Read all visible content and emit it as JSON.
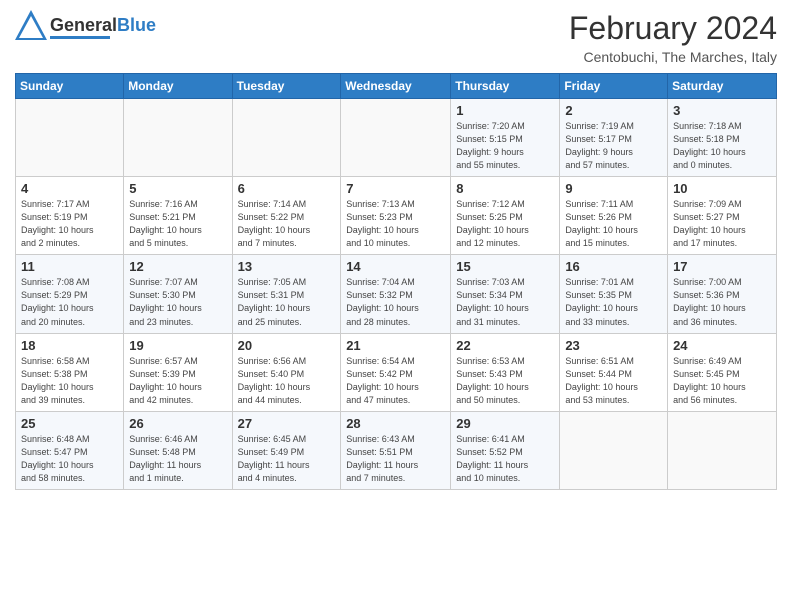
{
  "header": {
    "logo_general": "General",
    "logo_blue": "Blue",
    "month_title": "February 2024",
    "location": "Centobuchi, The Marches, Italy"
  },
  "weekdays": [
    "Sunday",
    "Monday",
    "Tuesday",
    "Wednesday",
    "Thursday",
    "Friday",
    "Saturday"
  ],
  "weeks": [
    [
      {
        "day": "",
        "info": ""
      },
      {
        "day": "",
        "info": ""
      },
      {
        "day": "",
        "info": ""
      },
      {
        "day": "",
        "info": ""
      },
      {
        "day": "1",
        "info": "Sunrise: 7:20 AM\nSunset: 5:15 PM\nDaylight: 9 hours\nand 55 minutes."
      },
      {
        "day": "2",
        "info": "Sunrise: 7:19 AM\nSunset: 5:17 PM\nDaylight: 9 hours\nand 57 minutes."
      },
      {
        "day": "3",
        "info": "Sunrise: 7:18 AM\nSunset: 5:18 PM\nDaylight: 10 hours\nand 0 minutes."
      }
    ],
    [
      {
        "day": "4",
        "info": "Sunrise: 7:17 AM\nSunset: 5:19 PM\nDaylight: 10 hours\nand 2 minutes."
      },
      {
        "day": "5",
        "info": "Sunrise: 7:16 AM\nSunset: 5:21 PM\nDaylight: 10 hours\nand 5 minutes."
      },
      {
        "day": "6",
        "info": "Sunrise: 7:14 AM\nSunset: 5:22 PM\nDaylight: 10 hours\nand 7 minutes."
      },
      {
        "day": "7",
        "info": "Sunrise: 7:13 AM\nSunset: 5:23 PM\nDaylight: 10 hours\nand 10 minutes."
      },
      {
        "day": "8",
        "info": "Sunrise: 7:12 AM\nSunset: 5:25 PM\nDaylight: 10 hours\nand 12 minutes."
      },
      {
        "day": "9",
        "info": "Sunrise: 7:11 AM\nSunset: 5:26 PM\nDaylight: 10 hours\nand 15 minutes."
      },
      {
        "day": "10",
        "info": "Sunrise: 7:09 AM\nSunset: 5:27 PM\nDaylight: 10 hours\nand 17 minutes."
      }
    ],
    [
      {
        "day": "11",
        "info": "Sunrise: 7:08 AM\nSunset: 5:29 PM\nDaylight: 10 hours\nand 20 minutes."
      },
      {
        "day": "12",
        "info": "Sunrise: 7:07 AM\nSunset: 5:30 PM\nDaylight: 10 hours\nand 23 minutes."
      },
      {
        "day": "13",
        "info": "Sunrise: 7:05 AM\nSunset: 5:31 PM\nDaylight: 10 hours\nand 25 minutes."
      },
      {
        "day": "14",
        "info": "Sunrise: 7:04 AM\nSunset: 5:32 PM\nDaylight: 10 hours\nand 28 minutes."
      },
      {
        "day": "15",
        "info": "Sunrise: 7:03 AM\nSunset: 5:34 PM\nDaylight: 10 hours\nand 31 minutes."
      },
      {
        "day": "16",
        "info": "Sunrise: 7:01 AM\nSunset: 5:35 PM\nDaylight: 10 hours\nand 33 minutes."
      },
      {
        "day": "17",
        "info": "Sunrise: 7:00 AM\nSunset: 5:36 PM\nDaylight: 10 hours\nand 36 minutes."
      }
    ],
    [
      {
        "day": "18",
        "info": "Sunrise: 6:58 AM\nSunset: 5:38 PM\nDaylight: 10 hours\nand 39 minutes."
      },
      {
        "day": "19",
        "info": "Sunrise: 6:57 AM\nSunset: 5:39 PM\nDaylight: 10 hours\nand 42 minutes."
      },
      {
        "day": "20",
        "info": "Sunrise: 6:56 AM\nSunset: 5:40 PM\nDaylight: 10 hours\nand 44 minutes."
      },
      {
        "day": "21",
        "info": "Sunrise: 6:54 AM\nSunset: 5:42 PM\nDaylight: 10 hours\nand 47 minutes."
      },
      {
        "day": "22",
        "info": "Sunrise: 6:53 AM\nSunset: 5:43 PM\nDaylight: 10 hours\nand 50 minutes."
      },
      {
        "day": "23",
        "info": "Sunrise: 6:51 AM\nSunset: 5:44 PM\nDaylight: 10 hours\nand 53 minutes."
      },
      {
        "day": "24",
        "info": "Sunrise: 6:49 AM\nSunset: 5:45 PM\nDaylight: 10 hours\nand 56 minutes."
      }
    ],
    [
      {
        "day": "25",
        "info": "Sunrise: 6:48 AM\nSunset: 5:47 PM\nDaylight: 10 hours\nand 58 minutes."
      },
      {
        "day": "26",
        "info": "Sunrise: 6:46 AM\nSunset: 5:48 PM\nDaylight: 11 hours\nand 1 minute."
      },
      {
        "day": "27",
        "info": "Sunrise: 6:45 AM\nSunset: 5:49 PM\nDaylight: 11 hours\nand 4 minutes."
      },
      {
        "day": "28",
        "info": "Sunrise: 6:43 AM\nSunset: 5:51 PM\nDaylight: 11 hours\nand 7 minutes."
      },
      {
        "day": "29",
        "info": "Sunrise: 6:41 AM\nSunset: 5:52 PM\nDaylight: 11 hours\nand 10 minutes."
      },
      {
        "day": "",
        "info": ""
      },
      {
        "day": "",
        "info": ""
      }
    ]
  ]
}
